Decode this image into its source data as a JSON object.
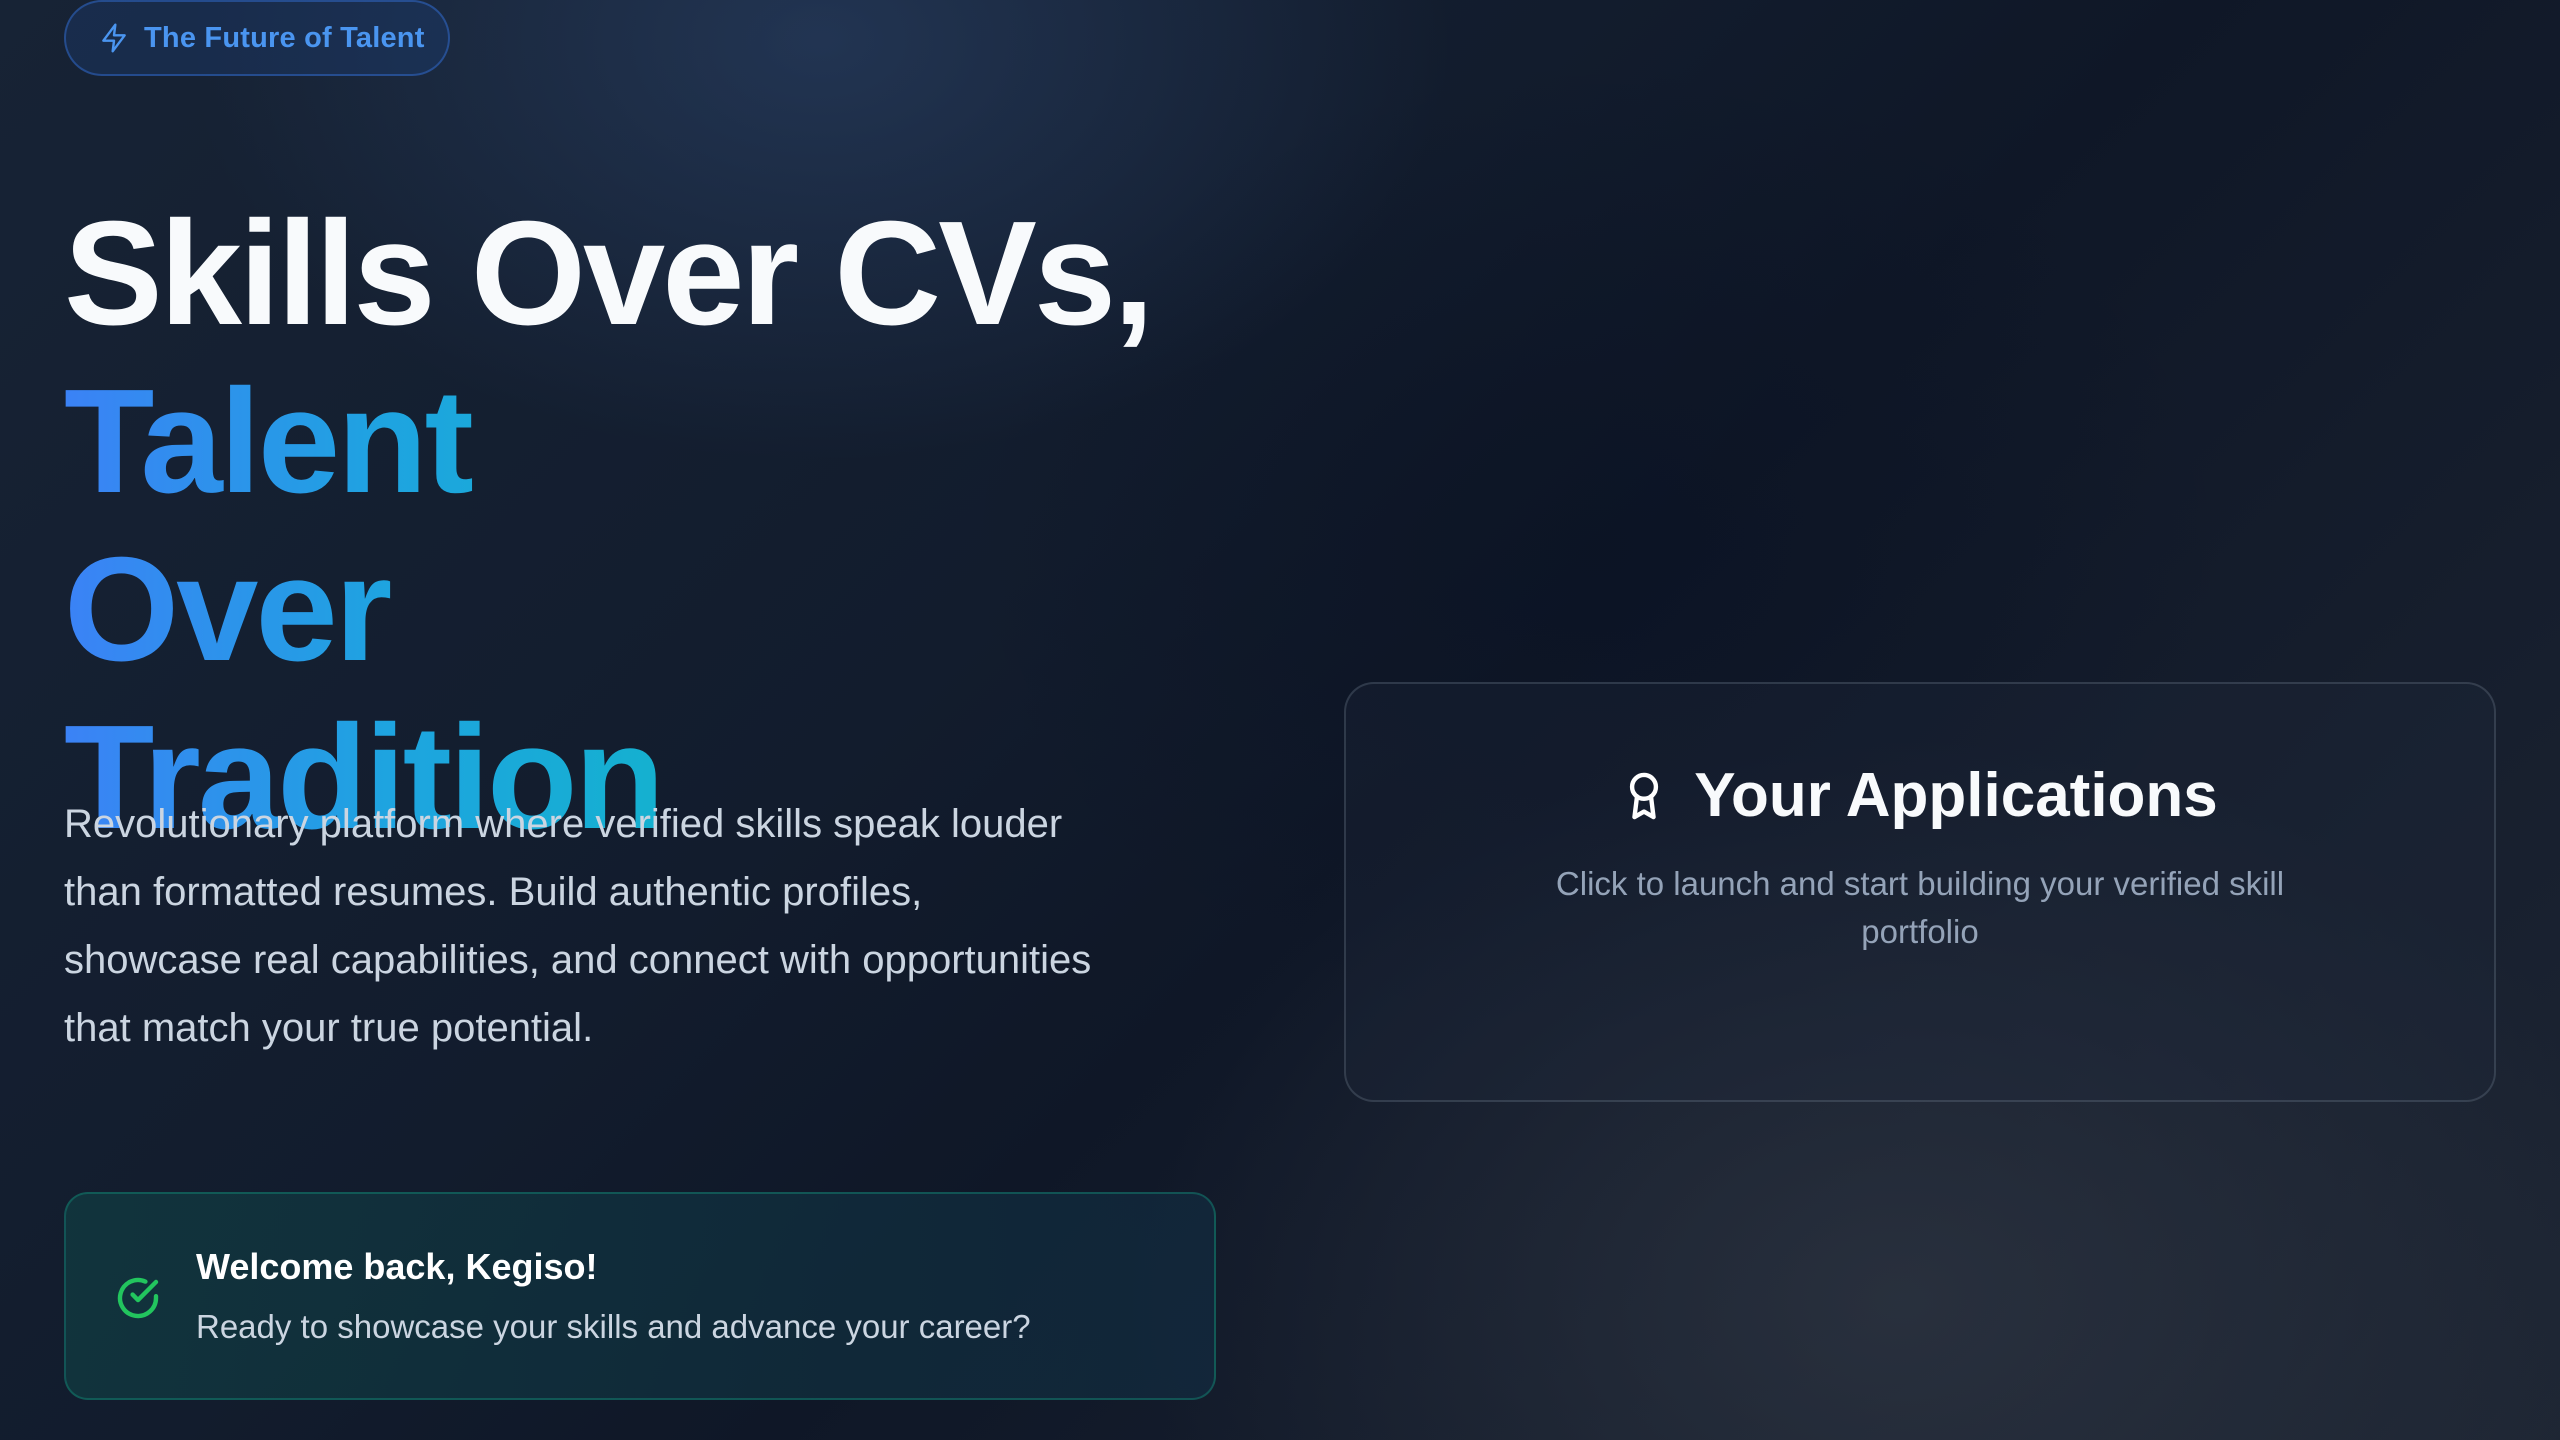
{
  "badge": {
    "label": "The Future of Talent",
    "icon": "lightning-icon"
  },
  "hero": {
    "headline_line1": "Skills Over CVs,",
    "headline_line2": "Talent Over Tradition",
    "description": "Revolutionary platform where verified skills speak louder than formatted resumes. Build authentic profiles, showcase real capabilities, and connect with opportunities that match your true potential."
  },
  "welcome": {
    "icon": "check-circle-icon",
    "title": "Welcome back, Kegiso!",
    "subtitle": "Ready to showcase your skills and advance your career?"
  },
  "applications": {
    "icon": "award-icon",
    "title": "Your Applications",
    "subtitle": "Click to launch and start building your verified skill portfolio"
  },
  "colors": {
    "accent_blue": "#3b82f6",
    "accent_cyan": "#10b6c8",
    "success_green": "#22c55e",
    "background": "#121c2d"
  }
}
